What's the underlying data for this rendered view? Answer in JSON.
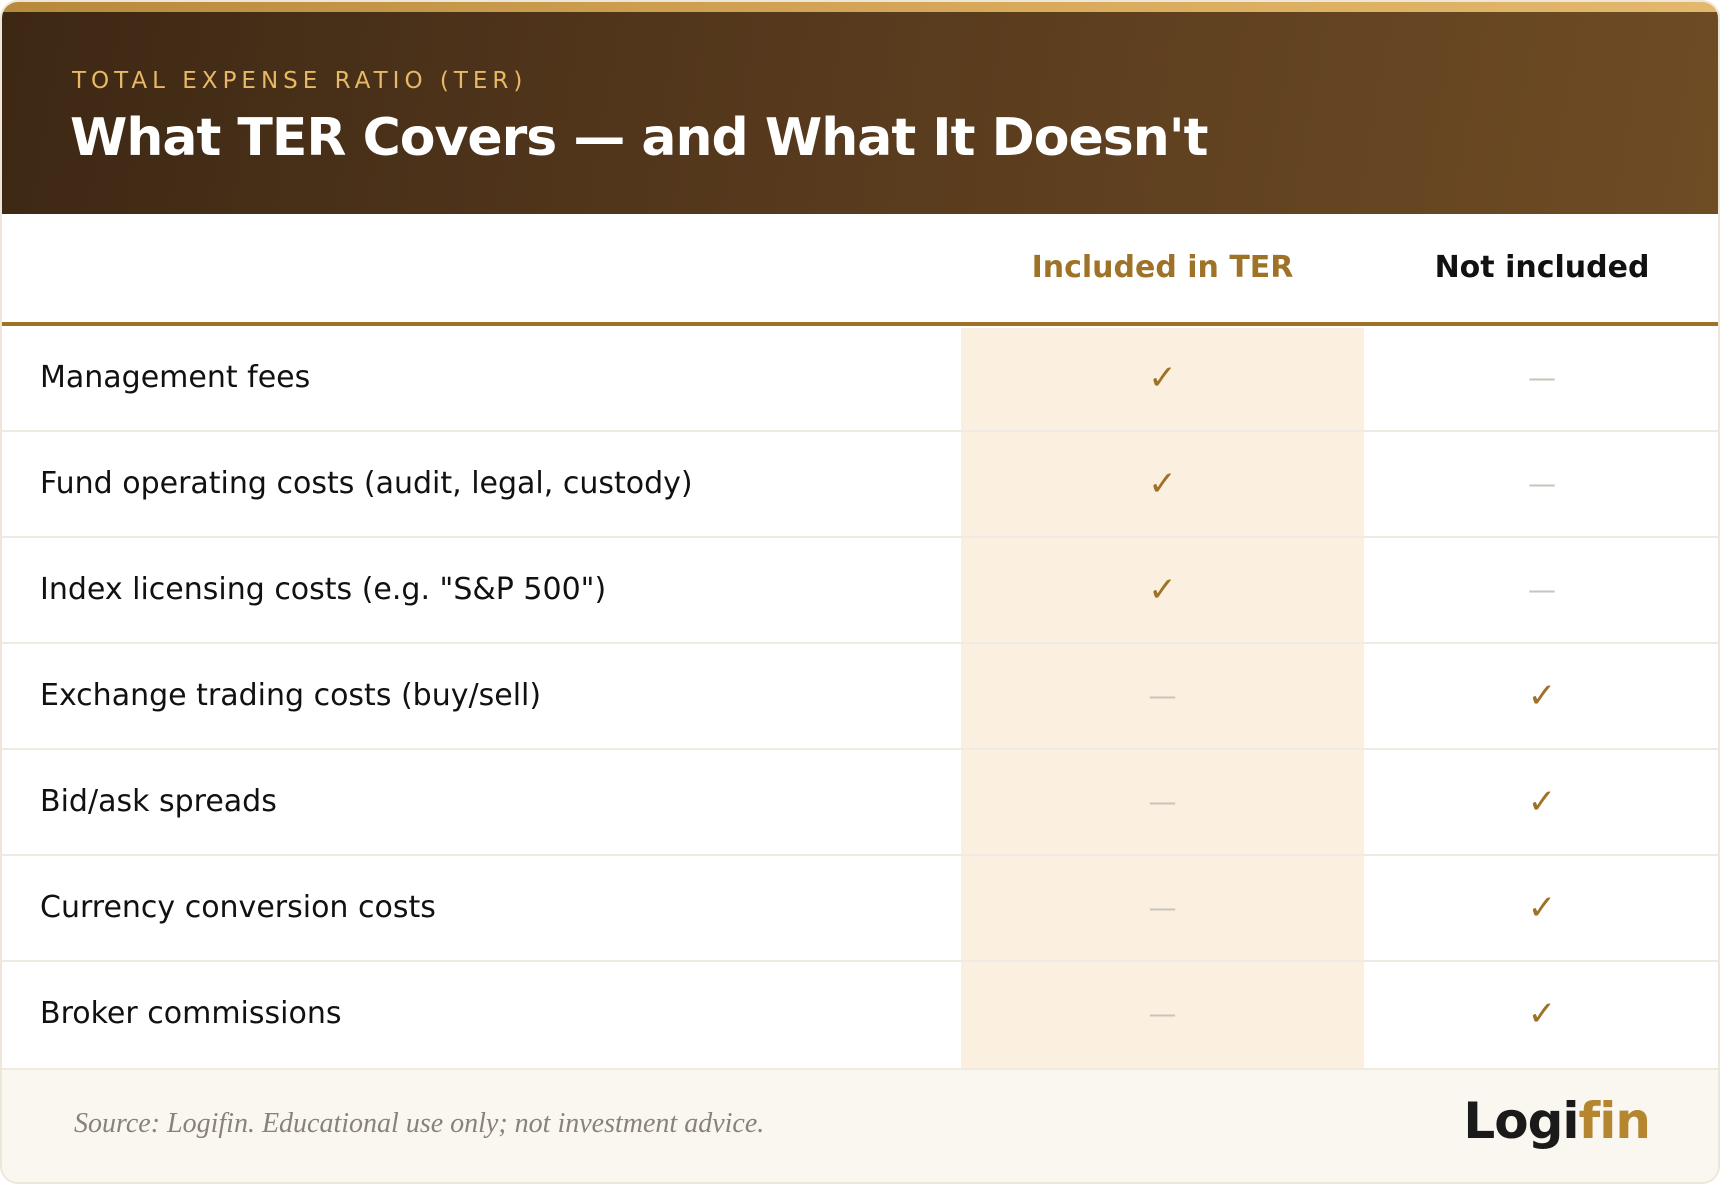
{
  "header": {
    "eyebrow": "TOTAL EXPENSE RATIO (TER)",
    "title": "What TER Covers — and What It Doesn't"
  },
  "table": {
    "columns": {
      "included": "Included in TER",
      "not_included": "Not included"
    },
    "rows": [
      {
        "label": "Management fees",
        "included": "✓",
        "not_included": "—"
      },
      {
        "label": "Fund operating costs (audit, legal, custody)",
        "included": "✓",
        "not_included": "—"
      },
      {
        "label": "Index licensing costs (e.g. \"S&P 500\")",
        "included": "✓",
        "not_included": "—"
      },
      {
        "label": "Exchange trading costs (buy/sell)",
        "included": "—",
        "not_included": "✓"
      },
      {
        "label": "Bid/ask spreads",
        "included": "—",
        "not_included": "✓"
      },
      {
        "label": "Currency conversion costs",
        "included": "—",
        "not_included": "✓"
      },
      {
        "label": "Broker commissions",
        "included": "—",
        "not_included": "✓"
      }
    ]
  },
  "footer": {
    "source": "Source: Logifin. Educational use only; not investment advice.",
    "logo_part1": "Logi",
    "logo_part2": "fin"
  },
  "colors": {
    "accent": "#9e7327",
    "header_dark": "#3d2814",
    "highlight_column": "#fbf0df"
  }
}
